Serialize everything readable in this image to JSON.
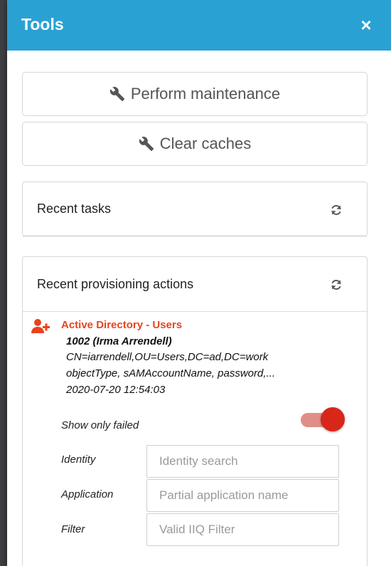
{
  "header": {
    "title": "Tools",
    "close_label": "×"
  },
  "tools": {
    "perform_maintenance": "Perform maintenance",
    "clear_caches": "Clear caches",
    "icon": "wrench-icon"
  },
  "recent_tasks": {
    "title": "Recent tasks",
    "refresh_icon": "refresh-icon"
  },
  "recent_provisioning": {
    "title": "Recent provisioning actions",
    "refresh_icon": "refresh-icon",
    "entries": [
      {
        "icon": "user-add-icon",
        "application": "Active Directory - Users",
        "identity": "1002 (Irma Arrendell)",
        "dn": "CN=iarrendell,OU=Users,DC=ad,DC=work",
        "attributes": "objectType, sAMAccountName, password,...",
        "timestamp": "2020-07-20 12:54:03"
      }
    ],
    "show_only_failed": {
      "label": "Show only failed",
      "enabled": true
    },
    "filters": {
      "identity": {
        "label": "Identity",
        "placeholder": "Identity search",
        "value": ""
      },
      "application": {
        "label": "Application",
        "placeholder": "Partial application name",
        "value": ""
      },
      "filter": {
        "label": "Filter",
        "placeholder": "Valid IIQ Filter",
        "value": ""
      }
    }
  },
  "colors": {
    "header_bg": "#2aa1d3",
    "accent_red": "#e8431d",
    "toggle_knob": "#d9261a",
    "toggle_track": "#e08f88"
  }
}
